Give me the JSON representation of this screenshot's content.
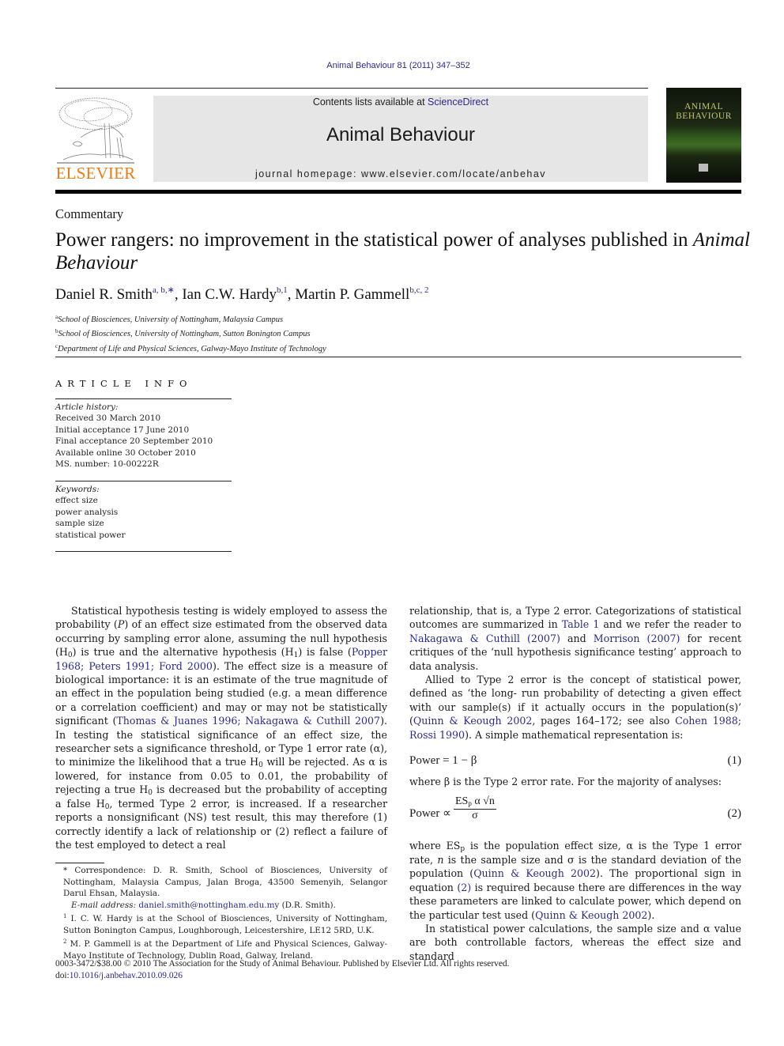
{
  "header": {
    "citation": "Animal Behaviour 81 (2011) 347–352",
    "publisher_logo_text": "ELSEVIER",
    "contents_prefix": "Contents lists available at ",
    "contents_link": "ScienceDirect",
    "journal_title": "Animal Behaviour",
    "homepage": "journal homepage: www.elsevier.com/locate/anbehav",
    "cover_title_line1": "ANIMAL",
    "cover_title_line2": "BEHAVIOUR",
    "colors": {
      "publisher_orange": "#f07b16",
      "link_blue": "#2a2a8c",
      "banner_gray": "#e6e6e6"
    }
  },
  "article": {
    "section": "Commentary",
    "title_main": "Power rangers: no improvement in the statistical power of analyses published in ",
    "title_italic": "Animal Behaviour",
    "authors": [
      {
        "name": "Daniel R. Smith",
        "sup": "a, b,∗",
        "sep": ", "
      },
      {
        "name": "Ian C.W. Hardy",
        "sup": "b,1",
        "sep": ", "
      },
      {
        "name": "Martin P. Gammell",
        "sup": "b,c, 2",
        "sep": ""
      }
    ],
    "affiliations": [
      {
        "key": "a",
        "text": "School of Biosciences, University of Nottingham, Malaysia Campus"
      },
      {
        "key": "b",
        "text": "School of Biosciences, University of Nottingham, Sutton Bonington Campus"
      },
      {
        "key": "c",
        "text": "Department of Life and Physical Sciences, Galway-Mayo Institute of Technology"
      }
    ]
  },
  "article_info": {
    "heading": "ARTICLE INFO",
    "history_label": "Article history:",
    "history": [
      "Received 30 March 2010",
      "Initial acceptance 17 June 2010",
      "Final acceptance 20 September 2010",
      "Available online 30 October 2010",
      "MS. number: 10-00222R"
    ],
    "keywords_label": "Keywords:",
    "keywords": [
      "effect size",
      "power analysis",
      "sample size",
      "statistical power"
    ]
  },
  "body": {
    "p1": {
      "t1": "Statistical hypothesis testing is widely employed to assess the probability (",
      "t1_italic": "P",
      "t2": ") of an effect size estimated from the observed data occurring by sampling error alone, assuming the null hypothesis (H",
      "sub0": "0",
      "t3": ") is true and the alternative hypothesis (H",
      "sub1": "1",
      "t4": ") is false (",
      "ref1": "Popper 1968; Peters 1991; Ford 2000",
      "t5": "). The effect size is a measure of biological importance: it is an estimate of the true magnitude of an effect in the population being studied (e.g. a mean difference or a correlation coefficient) and may or may not be statistically significant (",
      "ref2": "Thomas & Juanes 1996; Nakagawa & Cuthill 2007",
      "t6": "). In testing the statistical significance of an effect size, the researcher sets a significance threshold, or Type 1 error rate (α), to minimize the likelihood that a true H",
      "t7": " will be rejected. As α is lowered, for instance from 0.05 to 0.01, the probability of rejecting a true H",
      "t8": " is decreased but the probability of accepting a false H",
      "t9": ", termed Type 2 error, is increased. If a researcher reports a nonsignificant (NS) test result, this may therefore (1) correctly identify a lack of relationship or (2) reflect a failure of the test employed to detect a real relationship, that is, a Type 2 error. Categorizations of statistical outcomes are summarized in ",
      "ref3": "Table 1",
      "t10": " and we refer the reader to ",
      "ref4": "Nakagawa & Cuthill (2007)",
      "t11": " and ",
      "ref5": "Morrison (2007)",
      "t12": " for recent critiques of the ‘null hypothesis significance testing’ approach to data analysis."
    },
    "p2": {
      "t1": "Allied to Type 2 error is the concept of statistical power, defined as ‘the long- run probability of detecting a given effect with our sample(s) if it actually occurs in the population(s)’ (",
      "ref1": "Quinn & Keough 2002",
      "t2": ", pages 164–172; see also ",
      "ref2": "Cohen 1988; Rossi 1990",
      "t3": "). A simple mathematical representation is:"
    },
    "eq1": {
      "lhs": "Power = 1 − β",
      "number": "(1)"
    },
    "p3": "where β is the Type 2 error rate. For the majority of analyses:",
    "eq2": {
      "lhs": "Power ∝",
      "numerator": "ES",
      "numerator_sub": "p",
      "numerator_rest": " α √n",
      "denominator": "σ",
      "number": "(2)"
    },
    "p4": {
      "t1": "where ES",
      "sub": "p",
      "t2": " is the population effect size, α is the Type 1 error rate, ",
      "n": "n",
      "t3": " is the sample size and σ is the standard deviation of the population (",
      "ref1": "Quinn & Keough 2002",
      "t4": "). The proportional sign in equation ",
      "ref2": "(2)",
      "t5": " is required because there are differences in the way these parameters are linked to calculate power, which depend on the particular test used (",
      "ref3": "Quinn & Keough 2002",
      "t6": ")."
    },
    "p5": "In statistical power calculations, the sample size and α value are both controllable factors, whereas the effect size and standard"
  },
  "footnotes": {
    "star_mark": "*",
    "star_text": "Correspondence: D. R. Smith, School of Biosciences, University of Nottingham, Malaysia Campus, Jalan Broga, 43500 Semenyih, Selangor Darul Ehsan, Malaysia.",
    "email_label": "E-mail address: ",
    "email": "daniel.smith@nottingham.edu.my",
    "email_suffix": " (D.R. Smith).",
    "fn1_mark": "1",
    "fn1": "I. C. W. Hardy is at the School of Biosciences, University of Nottingham, Sutton Bonington Campus, Loughborough, Leicestershire, LE12 5RD, U.K.",
    "fn2_mark": "2",
    "fn2": "M. P. Gammell is at the Department of Life and Physical Sciences, Galway-Mayo Institute of Technology, Dublin Road, Galway, Ireland."
  },
  "footer": {
    "copyright": "0003-3472/$38.00 © 2010 The Association for the Study of Animal Behaviour. Published by Elsevier Ltd. All rights reserved.",
    "doi_label": "doi:",
    "doi": "10.1016/j.anbehav.2010.09.026"
  }
}
